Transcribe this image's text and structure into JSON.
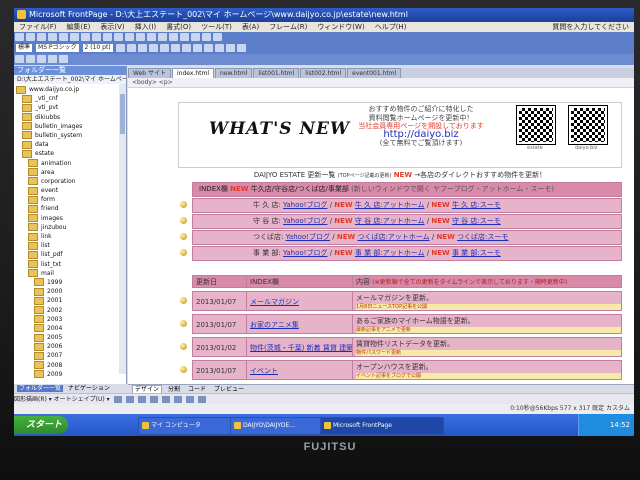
{
  "window": {
    "title": "Microsoft FrontPage - D:\\大上エステート_002\\マイ ホームページ\\www.daijyo.co.jp\\estate\\new.html",
    "right_status": "質問を入力してください"
  },
  "menu": [
    "ファイル(F)",
    "編集(E)",
    "表示(V)",
    "挿入(I)",
    "書式(O)",
    "ツール(T)",
    "表(A)",
    "フレーム(R)",
    "ウィンドウ(W)",
    "ヘルプ(H)"
  ],
  "toolbar": {
    "style": "標準",
    "font": "MS Pゴシック",
    "size": "2 (10 pt)"
  },
  "folder_pane": {
    "title": "フォルダー一覧",
    "path": "D:\\大上エステート_002\\マイ ホームページ",
    "items": [
      "www.daijyo.co.jp",
      "_vti_cnf",
      "_vti_pvt",
      "dikiubbs",
      "bulletin_images",
      "bulletin_system",
      "data",
      "estate",
      "animation",
      "area",
      "corporation",
      "event",
      "form",
      "friend",
      "images",
      "jinzubou",
      "link",
      "list",
      "list_pdf",
      "list_txt",
      "mail",
      "1999",
      "2000",
      "2001",
      "2002",
      "2003",
      "2004",
      "2005",
      "2006",
      "2007",
      "2008",
      "2009"
    ]
  },
  "doc_tabs": [
    "Web サイト",
    "index.html",
    "new.html",
    "list001.html",
    "list002.html",
    "event001.html"
  ],
  "editor_bar": "<body> <p>",
  "page": {
    "logo": "WHAT'S NEW",
    "promo_line1": "おすすめ物件のご紹介に特化した",
    "promo_line2": "資料閲覧ホームページを更新中！",
    "promo_line3": "当社会員専用ページを開設しております",
    "promo_url": "http://daiyo.biz",
    "promo_line4": "(全て無料でご覧頂けます)",
    "qr1_label": "estate",
    "qr2_label": "daiyo.biz",
    "section_title": "DAIJYO ESTATE 更新一覧",
    "section_title_note": "(TOPページ記載の更新)",
    "section_new": "NEW",
    "section_tail": "→各店のダイレクトおすすめ物件を更新！",
    "index_head": "INDEX欄",
    "index_head_text": "牛久店/守谷店/つくば店/事業部",
    "index_head_note": "(新しいウィンドウで開く ヤフーブログ・アットホーム・スーモ)",
    "stores": [
      {
        "name": "牛 久 店:",
        "blog": "Yahoo!ブログ",
        "at": "牛 久 店:アットホーム",
        "suumo": "牛 久 店:スーモ"
      },
      {
        "name": "守 谷 店:",
        "blog": "Yahoo!ブログ",
        "at": "守 谷 店:アットホーム",
        "suumo": "守 谷 店:スーモ"
      },
      {
        "name": "つくば店:",
        "blog": "Yahoo!ブログ",
        "at": "つくば店:アットホーム",
        "suumo": "つくば店:スーモ"
      },
      {
        "name": "事 業 部:",
        "blog": "Yahoo!ブログ",
        "at": "事 業 部:アットホーム",
        "suumo": "事 業 部:スーモ"
      }
    ],
    "sep": "/",
    "t2_head": {
      "date": "更新日",
      "index": "INDEX欄",
      "content": "内容",
      "content_note": "(※更新順で全ての更新をタイムラインで表示しております・随時更新中)"
    },
    "updates": [
      {
        "date": "2013/01/07",
        "index": "メールマガジン",
        "content": "メールマガジンを更新。",
        "sub": "1月8日ニュースTOP記事を公開"
      },
      {
        "date": "2013/01/07",
        "index": "お家のアニメ集",
        "content": "あるご家族のマイホーム物語を更新。",
        "sub": "最新記事をアニメで更新"
      },
      {
        "date": "2013/01/02",
        "index": "物件(茨城・千葉) 新着 賃貸 建築",
        "content": "賃貸物件リストデータを更新。",
        "sub": "物件パスワード更新"
      },
      {
        "date": "2013/01/07",
        "index": "イベント",
        "content": "オープンハウスを更新。",
        "sub": "イベント記事をブログで公開"
      }
    ]
  },
  "view_tabs": [
    "デザイン",
    "分割",
    "コード",
    "プレビュー"
  ],
  "pane_tabs": [
    "フォルダー一覧",
    "ナビゲーション"
  ],
  "drawbar": "図形描画(R) ▾  オートシェイプ(U) ▾",
  "status": {
    "right": "0:10秒@56Kbps   577 x 317   既定   カスタム"
  },
  "taskbar": {
    "start": "スタート",
    "buttons": [
      "マイ コンピュータ",
      "DAIJYO\\DAIJYOE...",
      "Microsoft FrontPage"
    ],
    "tray": "14:52"
  },
  "bezel_brand": "FUJITSU",
  "colors": {
    "title_blue": "#2d5cc8",
    "row_pink": "#e6b3c9",
    "head_pink": "#d98aa9",
    "link": "#1d2fb8",
    "new_red": "#e23b2b"
  }
}
